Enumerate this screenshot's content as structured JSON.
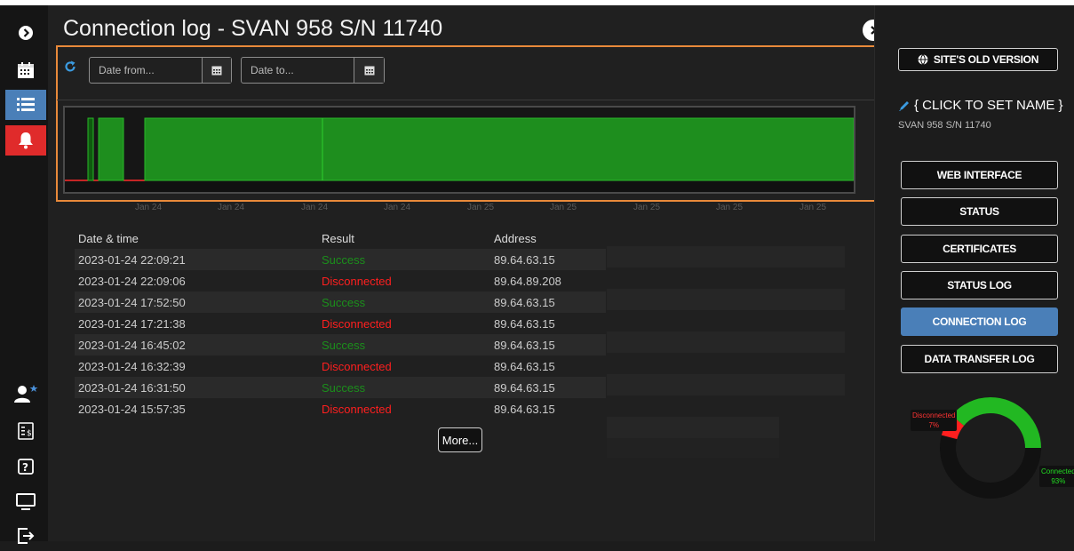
{
  "page": {
    "title": "Connection log - SVAN 958 S/N 11740"
  },
  "filters": {
    "date_from_placeholder": "Date from...",
    "date_to_placeholder": "Date to..."
  },
  "timeline": {
    "tick_labels": [
      "Jan 24",
      "Jan 24",
      "Jan 24",
      "Jan 24",
      "Jan 25",
      "Jan 25",
      "Jan 25",
      "Jan 25",
      "Jan 25"
    ],
    "colors": {
      "connected": "#1e8e1e",
      "disconnected": "#ff2a2a"
    }
  },
  "table": {
    "headers": [
      "Date & time",
      "Result",
      "Address"
    ],
    "rows": [
      {
        "datetime": "2023-01-24 22:09:21",
        "result": "Success",
        "address": "89.64.63.15"
      },
      {
        "datetime": "2023-01-24 22:09:06",
        "result": "Disconnected",
        "address": "89.64.89.208"
      },
      {
        "datetime": "2023-01-24 17:52:50",
        "result": "Success",
        "address": "89.64.63.15"
      },
      {
        "datetime": "2023-01-24 17:21:38",
        "result": "Disconnected",
        "address": "89.64.63.15"
      },
      {
        "datetime": "2023-01-24 16:45:02",
        "result": "Success",
        "address": "89.64.63.15"
      },
      {
        "datetime": "2023-01-24 16:32:39",
        "result": "Disconnected",
        "address": "89.64.63.15"
      },
      {
        "datetime": "2023-01-24 16:31:50",
        "result": "Success",
        "address": "89.64.63.15"
      },
      {
        "datetime": "2023-01-24 15:57:35",
        "result": "Disconnected",
        "address": "89.64.63.15"
      }
    ],
    "more_label": "More..."
  },
  "right_panel": {
    "old_version_label": "SITE'S OLD VERSION",
    "device_name": "{ CLICK TO SET NAME }",
    "device_serial": "SVAN 958 S/N 11740",
    "buttons": [
      "WEB INTERFACE",
      "STATUS",
      "CERTIFICATES",
      "STATUS LOG",
      "CONNECTION LOG",
      "DATA TRANSFER LOG"
    ],
    "active_button": "CONNECTION LOG"
  },
  "pie": {
    "disconnected_label": "Disconnected",
    "disconnected_pct": "7%",
    "connected_label": "Connected",
    "connected_pct": "93%",
    "disconnected_fraction": 0.07,
    "connected_fraction": 0.93
  },
  "colors": {
    "accent": "#e8893a",
    "success": "#1b8f1b",
    "error": "#ff1f1f",
    "active": "#4a7fb8"
  }
}
